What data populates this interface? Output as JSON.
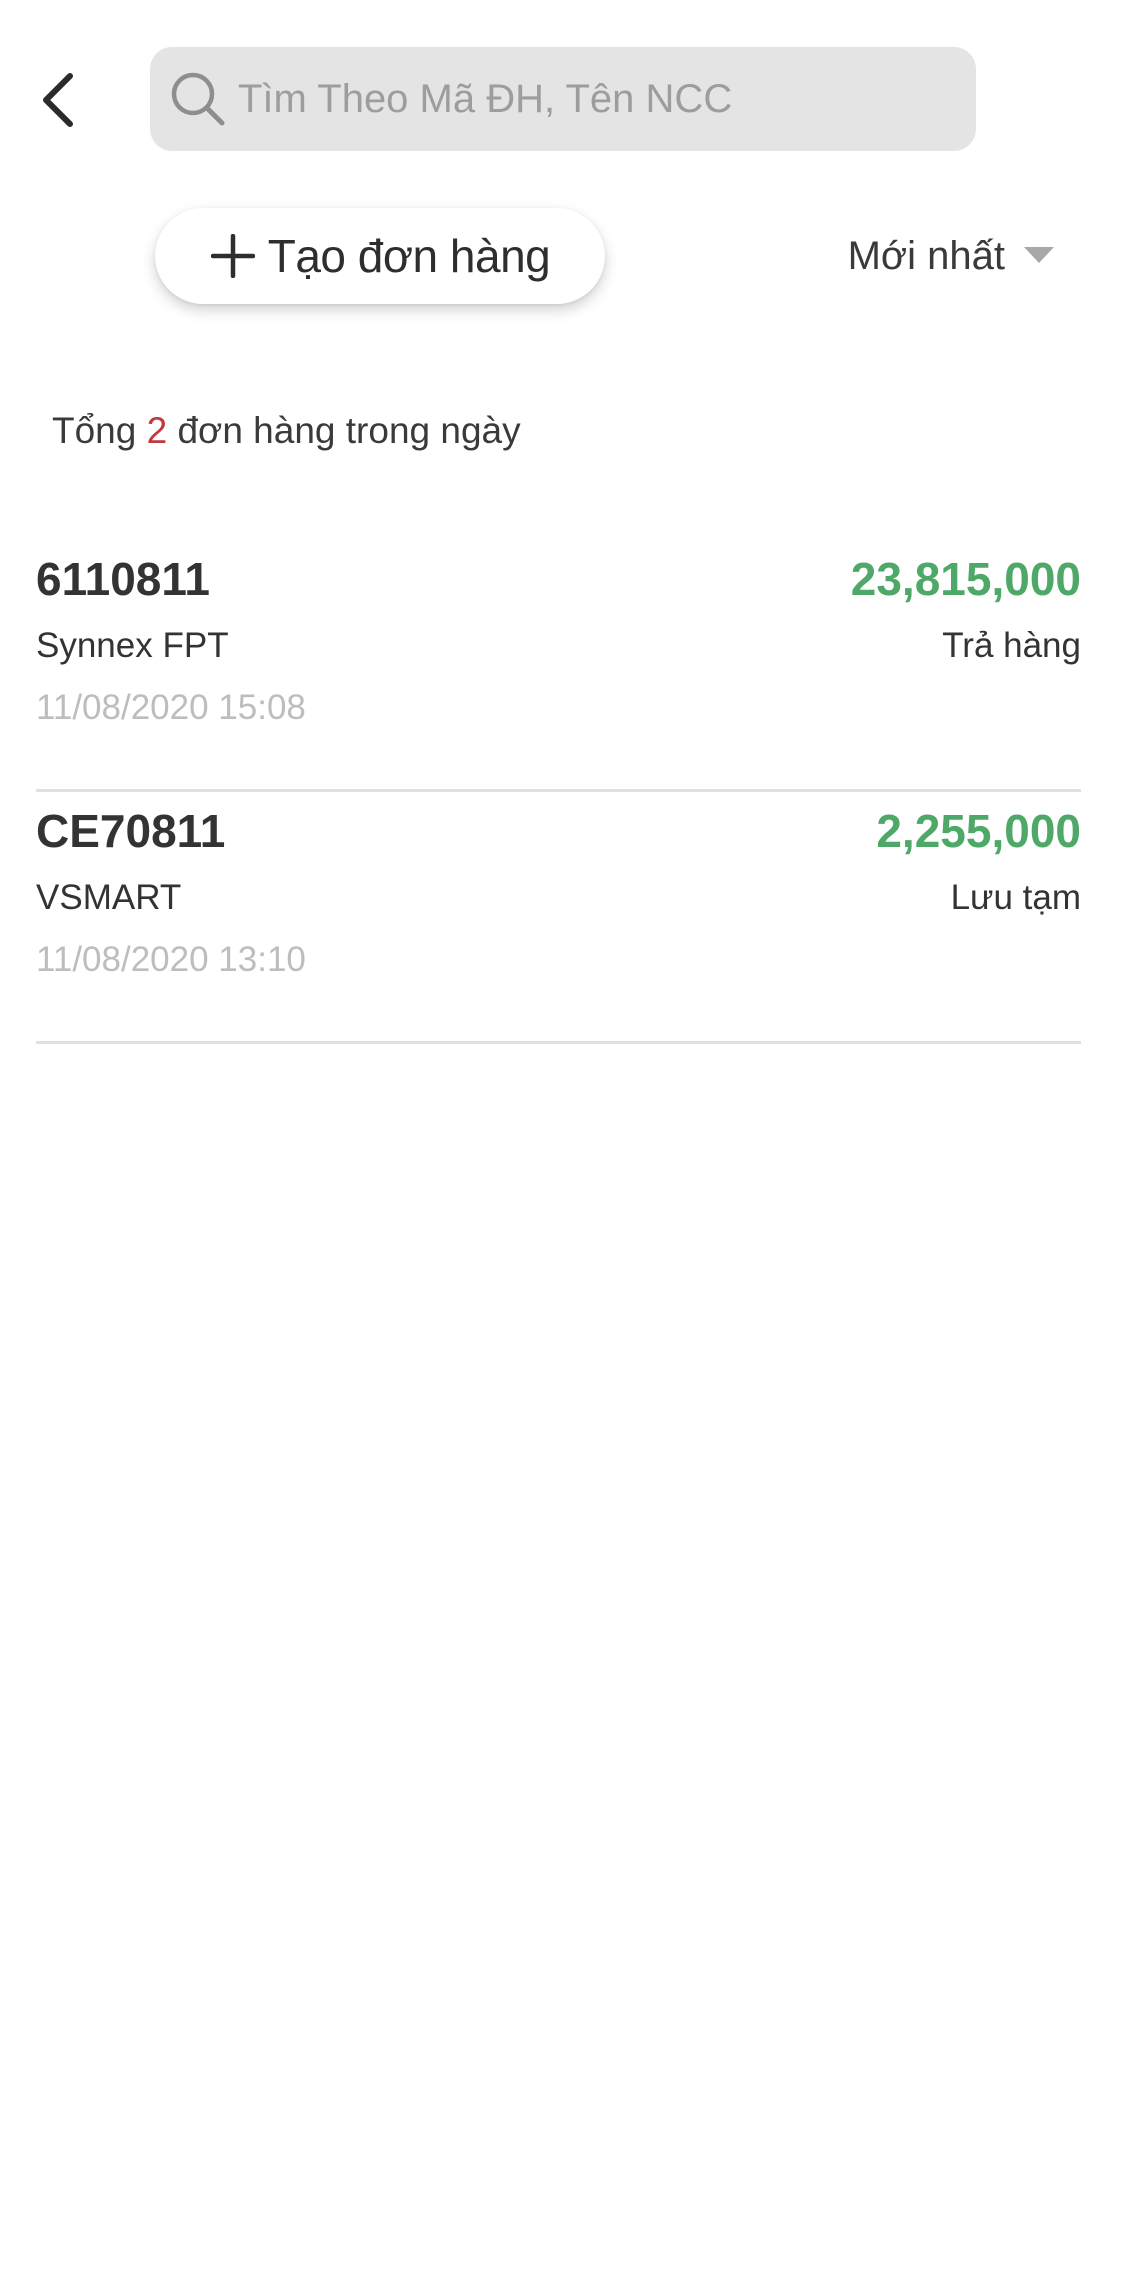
{
  "header": {
    "search": {
      "placeholder": "Tìm Theo Mã ĐH, Tên NCC",
      "value": ""
    }
  },
  "toolbar": {
    "create_label": "Tạo đơn hàng",
    "sort_label": "Mới nhất"
  },
  "summary": {
    "prefix": "Tổng",
    "count": "2",
    "suffix": "đơn hàng trong ngày"
  },
  "orders": [
    {
      "code": "6110811",
      "amount": "23,815,000",
      "supplier": "Synnex FPT",
      "status": "Trả hàng",
      "time": "11/08/2020 15:08"
    },
    {
      "code": "CE70811",
      "amount": "2,255,000",
      "supplier": "VSMART",
      "status": "Lưu tạm",
      "time": "11/08/2020 13:10"
    }
  ],
  "colors": {
    "amount": "#4ea867",
    "count_highlight": "#c0393b",
    "search_bg": "#e4e4e4",
    "muted_text": "#bdbdbd"
  },
  "icons": {
    "back": "chevron-left-icon",
    "search": "search-icon",
    "create": "plus-icon",
    "sort": "caret-down-icon"
  }
}
